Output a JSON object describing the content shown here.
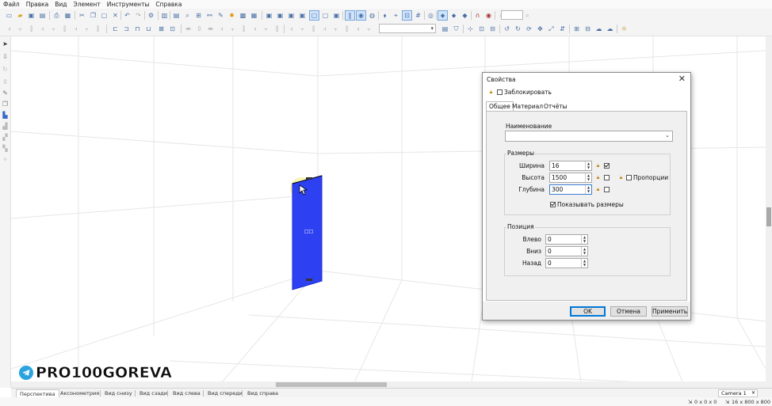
{
  "menu": [
    "Файл",
    "Правка",
    "Вид",
    "Элемент",
    "Инструменты",
    "Справка"
  ],
  "icons": {
    "toolbar": [
      "new-file-icon",
      "open-folder-icon",
      "save-icon",
      "save-as-icon",
      "print-icon",
      "print-preview-icon",
      "cut-icon",
      "copy-icon",
      "paste-icon",
      "delete-icon",
      "undo-icon",
      "redo-icon",
      "settings-icon",
      "report-icon",
      "search-icon",
      "tree-icon",
      "link-icon",
      "material-icon",
      "texture-icon",
      "table-icon",
      "view-front-icon",
      "view-top-icon",
      "view-side-icon",
      "view-iso-icon",
      "view-back-icon",
      "view-persp-icon",
      "view-wire-icon",
      "grid-icon",
      "pin-icon",
      "align-icon",
      "dimension-icon",
      "snap-icon",
      "zoom-fit-icon",
      "magnet-icon",
      "target-icon",
      "zoom-icon"
    ]
  },
  "colors": {
    "panel_blue": "#2d41f2",
    "accent": "#0078d7",
    "highlight": "#f7f2a8"
  },
  "panel_label": "□□",
  "dialog": {
    "title": "Свойства",
    "lock_label": "Заблокировать",
    "tabs": [
      "Общее",
      "Материал",
      "Отчёты"
    ],
    "name_label": "Наименование",
    "name_value": "",
    "sizes": {
      "title": "Размеры",
      "width_label": "Ширина",
      "width_value": "16",
      "height_label": "Высота",
      "height_value": "1500",
      "depth_label": "Глубина",
      "depth_value": "300",
      "proportions_label": "Пропорции",
      "show_sizes_label": "Показывать размеры"
    },
    "position": {
      "title": "Позиция",
      "left_label": "Влево",
      "left_value": "0",
      "down_label": "Вниз",
      "down_value": "0",
      "back_label": "Назад",
      "back_value": "0"
    },
    "buttons": {
      "ok": "OK",
      "cancel": "Отмена",
      "apply": "Применить"
    }
  },
  "watermark": "PRO100GOREVA",
  "view_tabs": [
    "Перспектива",
    "Аксонометрия",
    "Вид снизу",
    "Вид сзади",
    "Вид слева",
    "Вид спереди",
    "Вид справа"
  ],
  "camera_tab": "Camera 1",
  "status": {
    "coords": "0 x 0 x 0",
    "size": "16 x 800 x 800"
  }
}
